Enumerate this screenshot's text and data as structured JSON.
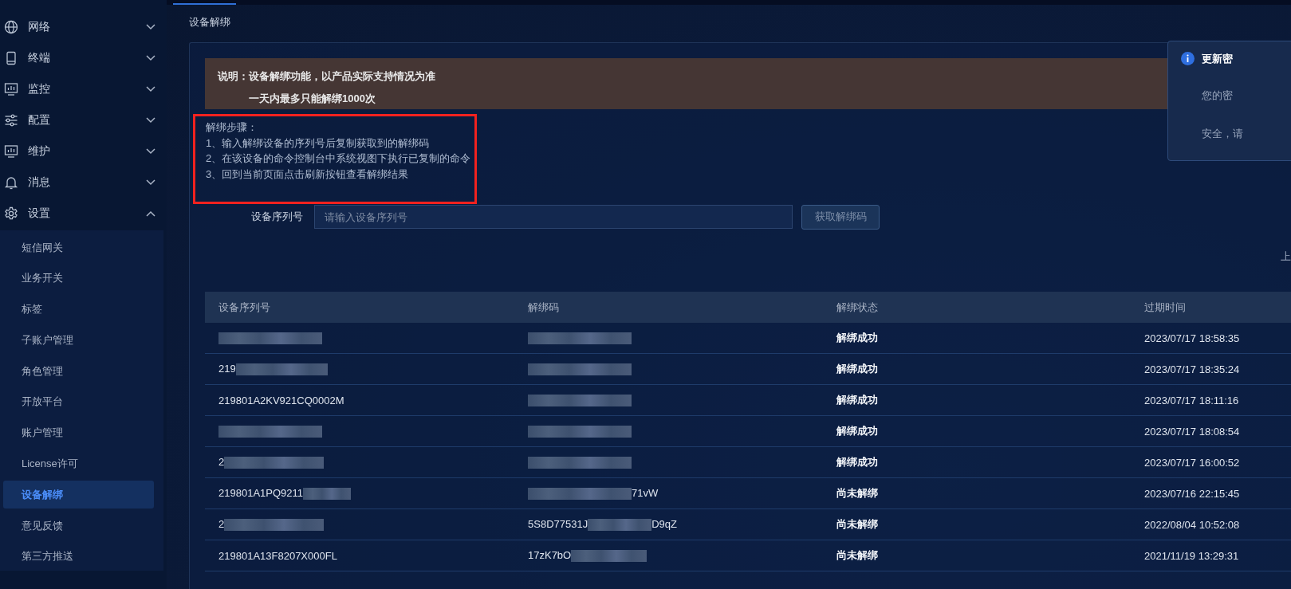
{
  "sidebar": {
    "items": [
      {
        "label": "网络",
        "expanded": false
      },
      {
        "label": "终端",
        "expanded": false
      },
      {
        "label": "监控",
        "expanded": false
      },
      {
        "label": "配置",
        "expanded": false
      },
      {
        "label": "维护",
        "expanded": false
      },
      {
        "label": "消息",
        "expanded": false
      },
      {
        "label": "设置",
        "expanded": true,
        "children": [
          {
            "label": "短信网关",
            "selected": false
          },
          {
            "label": "业务开关",
            "selected": false
          },
          {
            "label": "标签",
            "selected": false
          },
          {
            "label": "子账户管理",
            "selected": false
          },
          {
            "label": "角色管理",
            "selected": false
          },
          {
            "label": "开放平台",
            "selected": false
          },
          {
            "label": "账户管理",
            "selected": false
          },
          {
            "label": "License许可",
            "selected": false
          },
          {
            "label": "设备解绑",
            "selected": true
          },
          {
            "label": "意见反馈",
            "selected": false
          },
          {
            "label": "第三方推送",
            "selected": false
          }
        ]
      }
    ]
  },
  "breadcrumb": "设备解绑",
  "notice": {
    "title": "说明：",
    "lines": [
      "设备解绑功能，以产品实际支持情况为准",
      "一天内最多只能解绑1000次"
    ]
  },
  "steps": {
    "title": "解绑步骤：",
    "lines": [
      "1、输入解绑设备的序列号后复制获取到的解绑码",
      "2、在该设备的命令控制台中系统视图下执行已复制的命令",
      "3、回到当前页面点击刷新按钮查看解绑结果"
    ]
  },
  "form": {
    "label": "设备序列号",
    "placeholder": "请输入设备序列号",
    "button": "获取解绑码",
    "button_disabled": true
  },
  "refresh_text": "上",
  "table": {
    "columns": [
      "设备序列号",
      "解绑码",
      "解绑状态",
      "过期时间"
    ],
    "rows": [
      {
        "serial": {
          "redacted": true
        },
        "code": {
          "redacted": true
        },
        "status": "解绑成功",
        "expires": "2023/07/17 18:58:35"
      },
      {
        "serial": {
          "text": "219",
          "redacted": true
        },
        "code": {
          "redacted": true
        },
        "status": "解绑成功",
        "expires": "2023/07/17 18:35:24"
      },
      {
        "serial": {
          "text": "219801A2KV921CQ0002M",
          "redacted": false
        },
        "code": {
          "redacted": true
        },
        "status": "解绑成功",
        "expires": "2023/07/17 18:11:16"
      },
      {
        "serial": {
          "redacted": true
        },
        "code": {
          "redacted": true
        },
        "status": "解绑成功",
        "expires": "2023/07/17 18:08:54"
      },
      {
        "serial": {
          "text": "2",
          "redacted": true
        },
        "code": {
          "redacted": true
        },
        "status": "解绑成功",
        "expires": "2023/07/17 16:00:52"
      },
      {
        "serial": {
          "text": "219801A1PQ9211",
          "redacted": true
        },
        "code": {
          "redacted": true,
          "suffix": "71vW"
        },
        "status": "尚未解绑",
        "expires": "2023/07/16 22:15:45"
      },
      {
        "serial": {
          "text": "2",
          "redacted": true
        },
        "code": {
          "text": "5S8D77531J",
          "redacted": true,
          "suffix": "D9qZ"
        },
        "status": "尚未解绑",
        "expires": "2022/08/04 10:52:08"
      },
      {
        "serial": {
          "text": "219801A13F8207X000FL",
          "redacted": false
        },
        "code": {
          "text": "17zK7bO",
          "redacted": true
        },
        "status": "尚未解绑",
        "expires": "2021/11/19 13:29:31"
      }
    ]
  },
  "notification": {
    "title": "更新密",
    "lines": [
      "您的密",
      "安全，请"
    ]
  }
}
